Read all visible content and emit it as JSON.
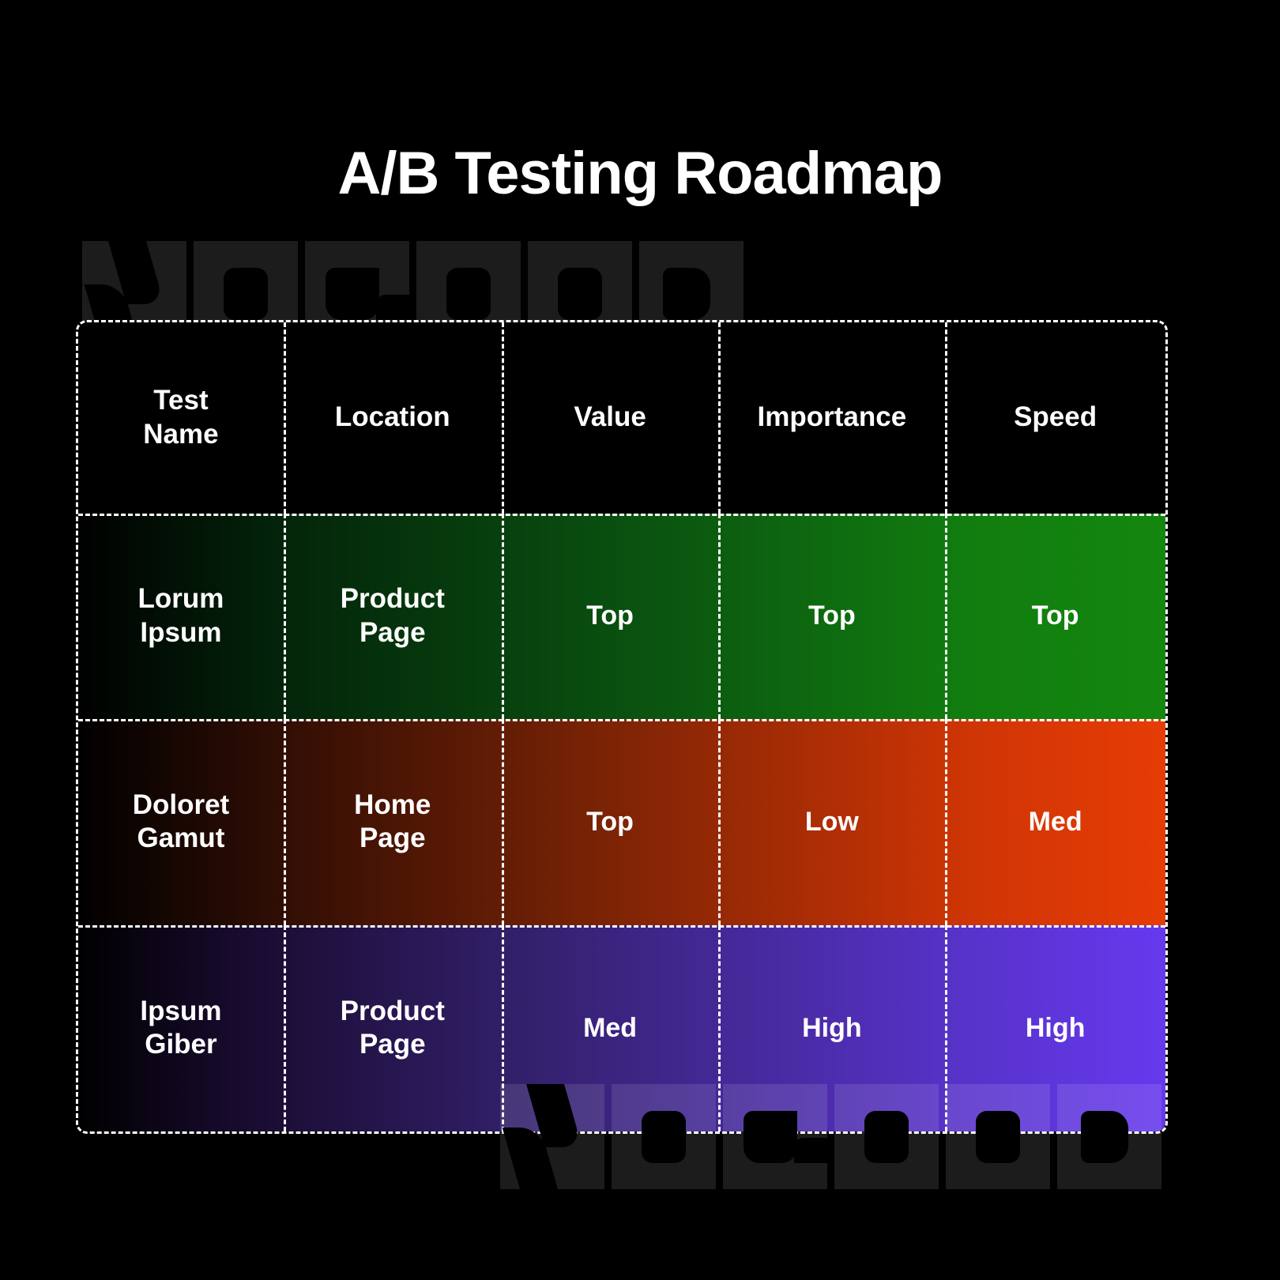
{
  "page": {
    "title": "A/B Testing Roadmap",
    "background_color": "#000000",
    "text_color": "#ffffff"
  },
  "watermark": {
    "text": "NOGOOD",
    "letters": [
      "N",
      "O",
      "G",
      "O",
      "O",
      "D"
    ],
    "top_color": "#1c1c1c",
    "bottom_color": "rgba(255,255,255,0.11)"
  },
  "table": {
    "name": "ab-testing-roadmap-table",
    "border_style": "dashed",
    "border_color": "#ffffff",
    "columns": [
      "Test Name",
      "Location",
      "Value",
      "Importance",
      "Speed"
    ],
    "header": {
      "cells": [
        {
          "line1": "Test",
          "line2": "Name"
        },
        {
          "line1": "Location",
          "line2": ""
        },
        {
          "line1": "Value",
          "line2": ""
        },
        {
          "line1": "Importance",
          "line2": ""
        },
        {
          "line1": "Speed",
          "line2": ""
        }
      ]
    },
    "rows": [
      {
        "accent": "#14870f",
        "accent_name": "green",
        "test_name_line1": "Lorum",
        "test_name_line2": "Ipsum",
        "location_line1": "Product",
        "location_line2": "Page",
        "value": "Top",
        "importance": "Top",
        "speed": "Top"
      },
      {
        "accent": "#e63c05",
        "accent_name": "orange",
        "test_name_line1": "Doloret",
        "test_name_line2": "Gamut",
        "location_line1": "Home",
        "location_line2": "Page",
        "value": "Top",
        "importance": "Low",
        "speed": "Med"
      },
      {
        "accent": "#6639ee",
        "accent_name": "purple",
        "test_name_line1": "Ipsum",
        "test_name_line2": "Giber",
        "location_line1": "Product",
        "location_line2": "Page",
        "value": "Med",
        "importance": "High",
        "speed": "High"
      }
    ]
  }
}
